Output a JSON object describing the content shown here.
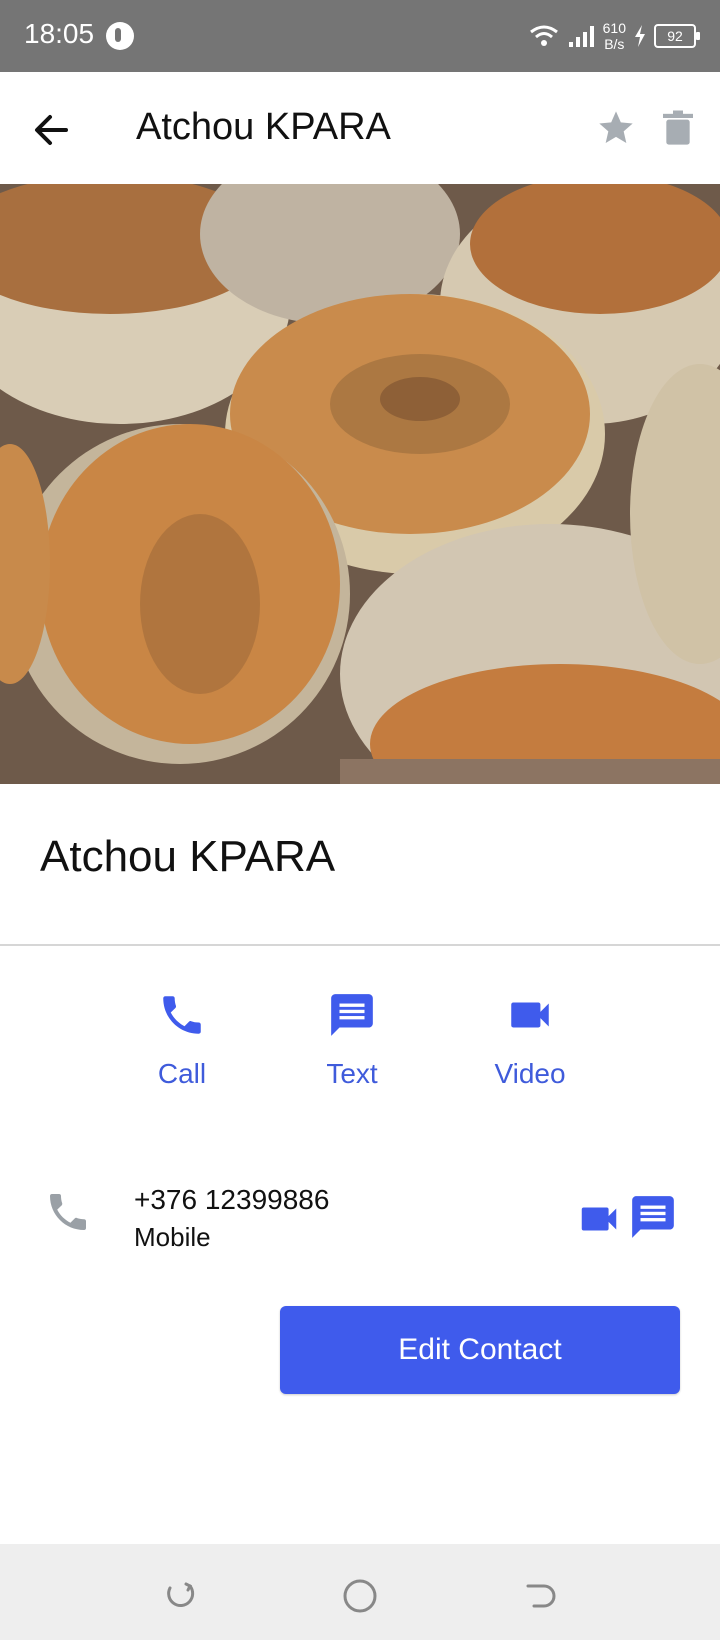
{
  "status_bar": {
    "time": "18:05",
    "net_speed_value": "610",
    "net_speed_unit": "B/s",
    "battery": "92"
  },
  "app_bar": {
    "title": "Atchou KPARA",
    "back_icon": "arrow-left-icon",
    "star_icon": "star-icon",
    "delete_icon": "trash-icon"
  },
  "contact": {
    "name": "Atchou KPARA",
    "photo_description": "muffins"
  },
  "actions": [
    {
      "label": "Call",
      "icon": "phone-icon"
    },
    {
      "label": "Text",
      "icon": "message-icon"
    },
    {
      "label": "Video",
      "icon": "video-icon"
    }
  ],
  "phone": {
    "number": "+376 12399886",
    "type": "Mobile"
  },
  "edit_button": "Edit Contact",
  "colors": {
    "accent": "#3f5bec",
    "status_bar": "#757575",
    "icon_gray": "#9aa0a6"
  }
}
